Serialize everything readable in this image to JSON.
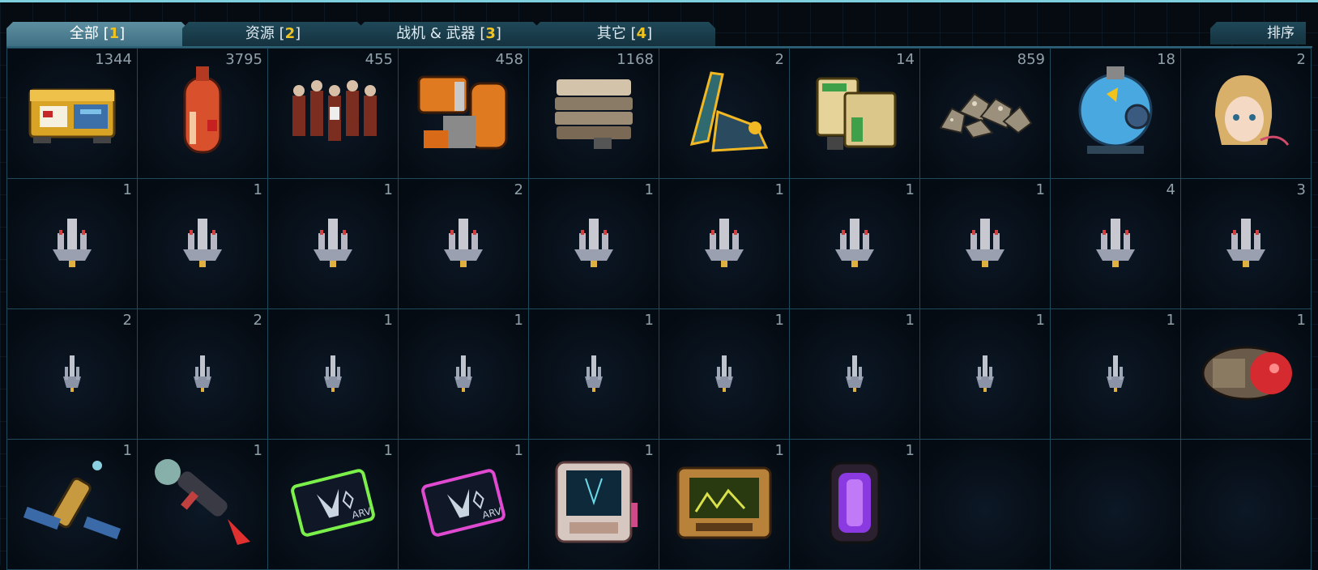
{
  "tabs": [
    {
      "label": "全部",
      "num": "1",
      "open": "[",
      "close": "]"
    },
    {
      "label": "资源",
      "num": "2",
      "open": "[",
      "close": "]"
    },
    {
      "label": "战机 & 武器",
      "num": "3",
      "open": "[",
      "close": "]"
    },
    {
      "label": "其它",
      "num": "4",
      "open": "[",
      "close": "]"
    }
  ],
  "sort_label": "排序",
  "items": [
    {
      "count": "1344",
      "icon": "crate-icon"
    },
    {
      "count": "3795",
      "icon": "fuel-tank-icon"
    },
    {
      "count": "455",
      "icon": "soldiers-icon"
    },
    {
      "count": "458",
      "icon": "machinery-icon"
    },
    {
      "count": "1168",
      "icon": "alloy-stack-icon"
    },
    {
      "count": "2",
      "icon": "blade-module-icon"
    },
    {
      "count": "14",
      "icon": "supply-boxes-icon"
    },
    {
      "count": "859",
      "icon": "ore-icon"
    },
    {
      "count": "18",
      "icon": "energy-sphere-icon"
    },
    {
      "count": "2",
      "icon": "pilot-portrait-icon"
    },
    {
      "count": "1",
      "icon": "fighter-ship-icon"
    },
    {
      "count": "1",
      "icon": "fighter-ship-icon"
    },
    {
      "count": "1",
      "icon": "fighter-ship-icon"
    },
    {
      "count": "2",
      "icon": "fighter-ship-icon"
    },
    {
      "count": "1",
      "icon": "fighter-ship-icon"
    },
    {
      "count": "1",
      "icon": "fighter-ship-icon"
    },
    {
      "count": "1",
      "icon": "fighter-ship-icon"
    },
    {
      "count": "1",
      "icon": "fighter-ship-icon"
    },
    {
      "count": "4",
      "icon": "fighter-ship-icon"
    },
    {
      "count": "3",
      "icon": "fighter-ship-icon"
    },
    {
      "count": "2",
      "icon": "small-ship-icon"
    },
    {
      "count": "2",
      "icon": "small-ship-icon"
    },
    {
      "count": "1",
      "icon": "small-ship-icon"
    },
    {
      "count": "1",
      "icon": "small-ship-icon"
    },
    {
      "count": "1",
      "icon": "small-ship-icon"
    },
    {
      "count": "1",
      "icon": "small-ship-icon"
    },
    {
      "count": "1",
      "icon": "small-ship-icon"
    },
    {
      "count": "1",
      "icon": "small-ship-icon"
    },
    {
      "count": "1",
      "icon": "small-ship-icon"
    },
    {
      "count": "1",
      "icon": "capsule-icon"
    },
    {
      "count": "1",
      "icon": "satellite-icon"
    },
    {
      "count": "1",
      "icon": "probe-rocket-icon"
    },
    {
      "count": "1",
      "icon": "blueprint-card-icon",
      "card_text": "ARV"
    },
    {
      "count": "1",
      "icon": "blueprint-card-icon",
      "card_text": "ARV"
    },
    {
      "count": "1",
      "icon": "data-tablet-icon"
    },
    {
      "count": "1",
      "icon": "screen-panel-icon"
    },
    {
      "count": "1",
      "icon": "portal-gate-icon"
    },
    {
      "count": "",
      "icon": ""
    },
    {
      "count": "",
      "icon": ""
    },
    {
      "count": "",
      "icon": ""
    }
  ],
  "colors": {
    "accent": "#f2c21d",
    "tab_active": "#5c8fa1",
    "tab_inactive": "#1f4858",
    "grid_line": "#1e4a5c"
  }
}
